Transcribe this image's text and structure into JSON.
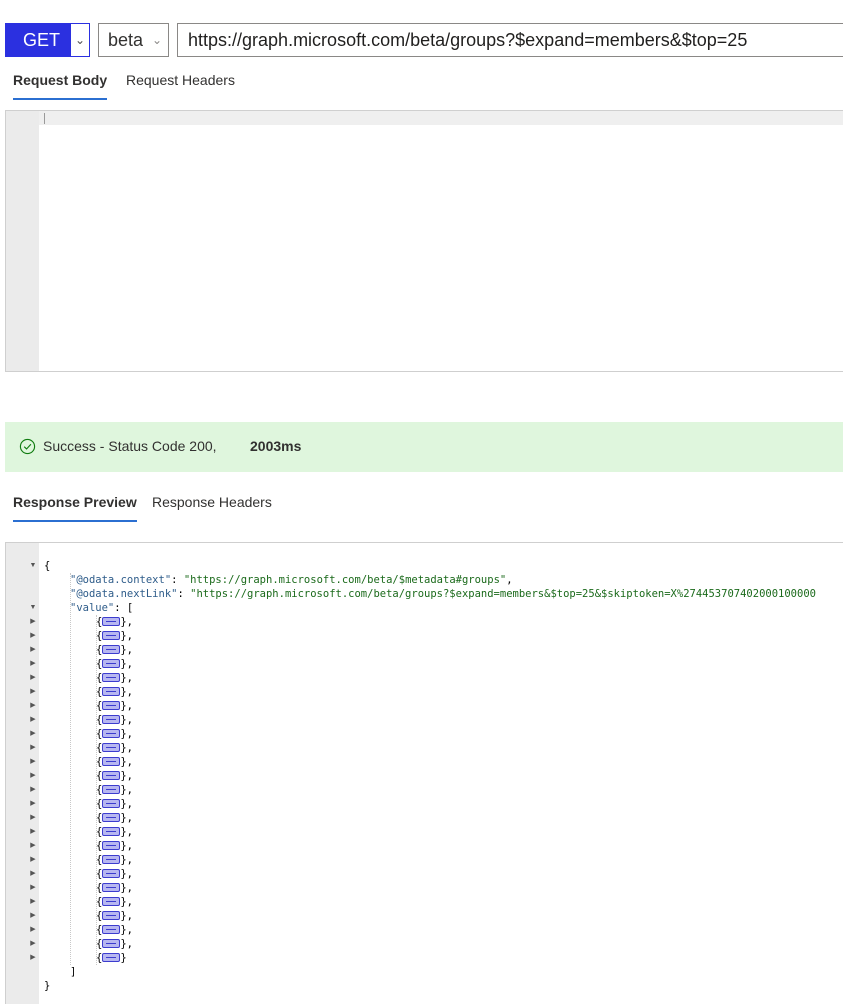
{
  "request": {
    "method": "GET",
    "method_caret": "⌄",
    "version": "beta",
    "version_caret": "⌄",
    "url": "https://graph.microsoft.com/beta/groups?$expand=members&$top=25"
  },
  "request_tabs": [
    "Request Body",
    "Request Headers"
  ],
  "status": {
    "message": "Success - Status Code 200,",
    "duration": "2003ms",
    "icon": "check-circle-icon",
    "color": "#dff6dd"
  },
  "response_tabs": [
    "Response Preview",
    "Response Headers"
  ],
  "response": {
    "open_brace": "{",
    "context_key": "\"@odata.context\"",
    "context_value": "\"https://graph.microsoft.com/beta/$metadata#groups\"",
    "next_key": "\"@odata.nextLink\"",
    "next_value": "\"https://graph.microsoft.com/beta/groups?$expand=members&$top=25&$skiptoken=X%274453707402000100000",
    "value_key": "\"value\"",
    "collapsed_item_count": 25,
    "close_bracket": "]",
    "close_brace": "}"
  },
  "colors": {
    "accent": "#2b30e0",
    "tab_underline": "#2b6fd1",
    "json_key": "#2e5c8a",
    "json_string": "#1b6a1b"
  }
}
